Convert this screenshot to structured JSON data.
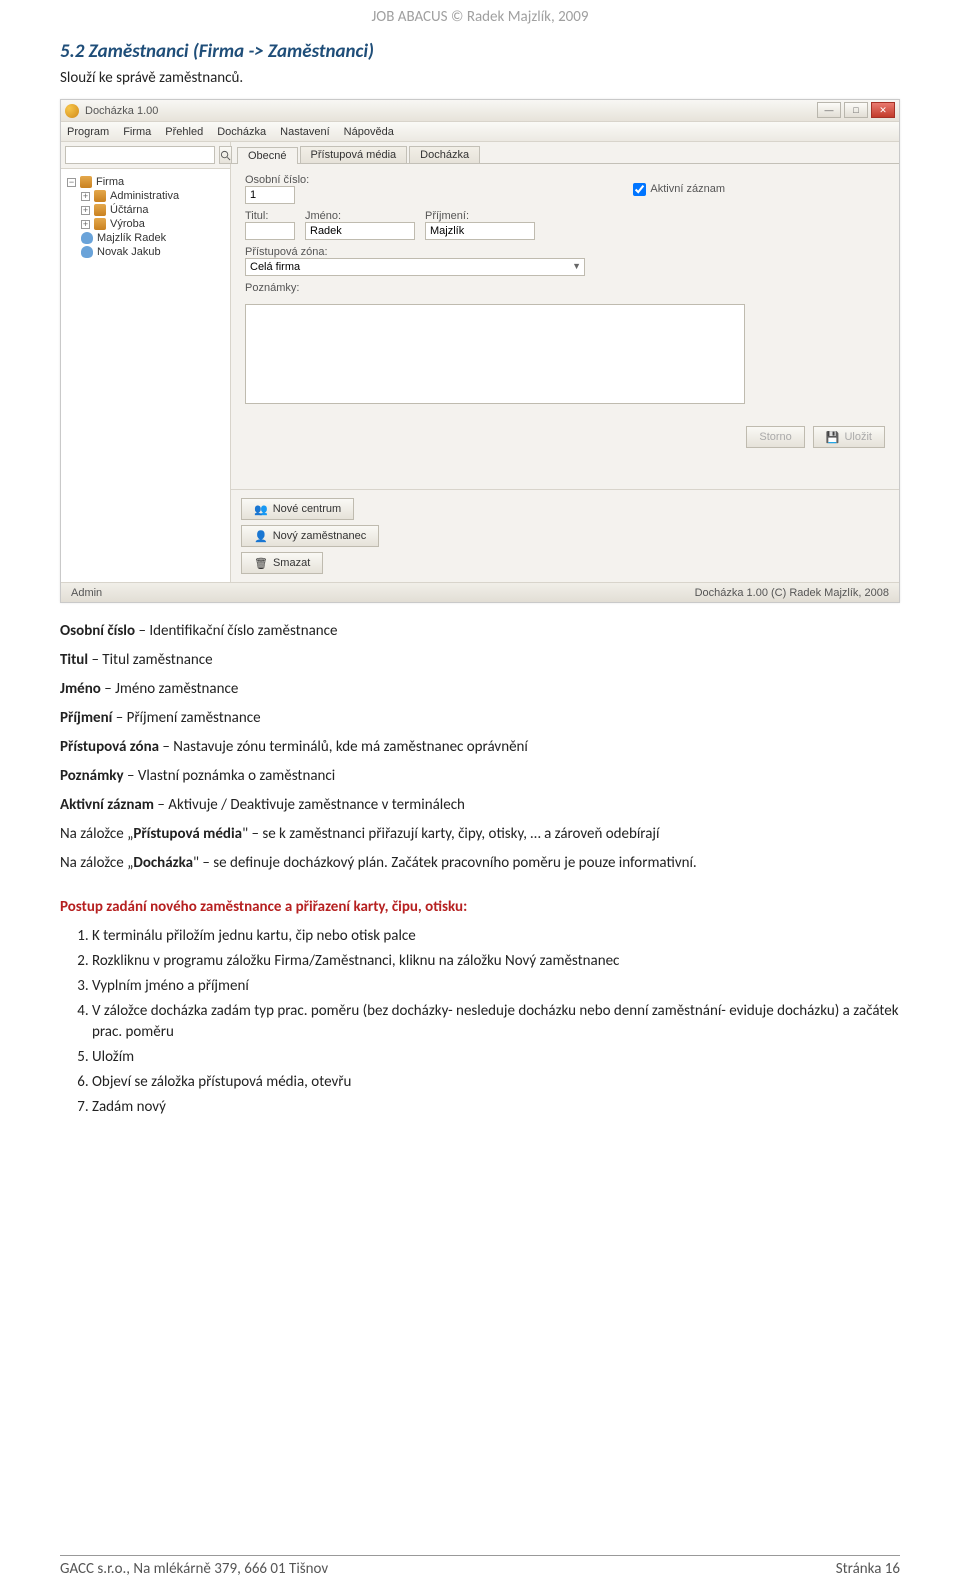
{
  "header": {
    "line": "JOB ABACUS © Radek Majzlík, 2009"
  },
  "section": {
    "title": "5.2 Zaměstnanci (Firma -> Zaměstnanci)"
  },
  "intro": "Slouží ke správě zaměstnanců.",
  "app": {
    "title": "Docházka 1.00",
    "menu": [
      "Program",
      "Firma",
      "Přehled",
      "Docházka",
      "Nastavení",
      "Nápověda"
    ],
    "tree": {
      "root": "Firma",
      "nodes": [
        "Administrativa",
        "Účtárna",
        "Výroba"
      ],
      "people": [
        "Majzlík Radek",
        "Novak Jakub"
      ]
    },
    "tabs": [
      "Obecné",
      "Přístupová média",
      "Docházka"
    ],
    "form": {
      "osobni_cislo_label": "Osobní číslo:",
      "osobni_cislo": "1",
      "active_label": "Aktivní záznam",
      "active_checked": true,
      "titul_label": "Titul:",
      "titul": "",
      "jmeno_label": "Jméno:",
      "jmeno": "Radek",
      "prijmeni_label": "Příjmení:",
      "prijmeni": "Majzlík",
      "zona_label": "Přístupová zóna:",
      "zona": "Celá firma",
      "poznamky_label": "Poznámky:"
    },
    "buttons": {
      "storno": "Storno",
      "ulozit": "Uložit",
      "nove_centrum": "Nové centrum",
      "novy_zamestnanec": "Nový zaměstnanec",
      "smazat": "Smazat"
    },
    "status": {
      "left": "Admin",
      "right": "Docházka 1.00 (C) Radek Majzlík, 2008"
    }
  },
  "defs": {
    "osobni_cislo": {
      "t": "Osobní číslo",
      "d": " – Identifikační číslo zaměstnance"
    },
    "titul": {
      "t": "Titul",
      "d": " – Titul zaměstnance"
    },
    "jmeno": {
      "t": "Jméno",
      "d": " – Jméno zaměstnance"
    },
    "prijmeni": {
      "t": "Příjmení",
      "d": " – Příjmení zaměstnance"
    },
    "zona": {
      "t": "Přístupová zóna",
      "d": " – Nastavuje zónu terminálů, kde má zaměstnanec oprávnění"
    },
    "poznamky": {
      "t": "Poznámky",
      "d": " – Vlastní poznámka o zaměstnanci"
    },
    "aktivni": {
      "t": "Aktivní záznam",
      "d": " – Aktivuje / Deaktivuje zaměstnance v terminálech"
    }
  },
  "para_media": {
    "pre": "Na záložce „",
    "b": "Přístupová média",
    "post": "\" – se k zaměstnanci přiřazují karty, čipy, otisky, … a zároveň odebírají"
  },
  "para_dochazka": {
    "pre": "Na záložce „",
    "b": "Docházka",
    "post": "\" – se definuje docházkový plán. Začátek pracovního poměru je pouze informativní."
  },
  "red": "Postup zadání nového zaměstnance a přiřazení karty, čipu, otisku:",
  "steps": [
    "K terminálu přiložím jednu kartu, čip nebo otisk palce",
    "Rozkliknu v programu záložku Firma/Zaměstnanci, kliknu na záložku Nový zaměstnanec",
    "Vyplním jméno a příjmení",
    "V záložce docházka zadám typ prac. poměru (bez docházky- nesleduje docházku nebo denní zaměstnání- eviduje docházku) a začátek prac. poměru",
    "Uložím",
    "Objeví se záložka přístupová média, otevřu",
    "Zadám nový"
  ],
  "footer": {
    "left": "GACC s.r.o., Na mlékárně 379, 666 01 Tišnov",
    "right": "Stránka 16"
  }
}
